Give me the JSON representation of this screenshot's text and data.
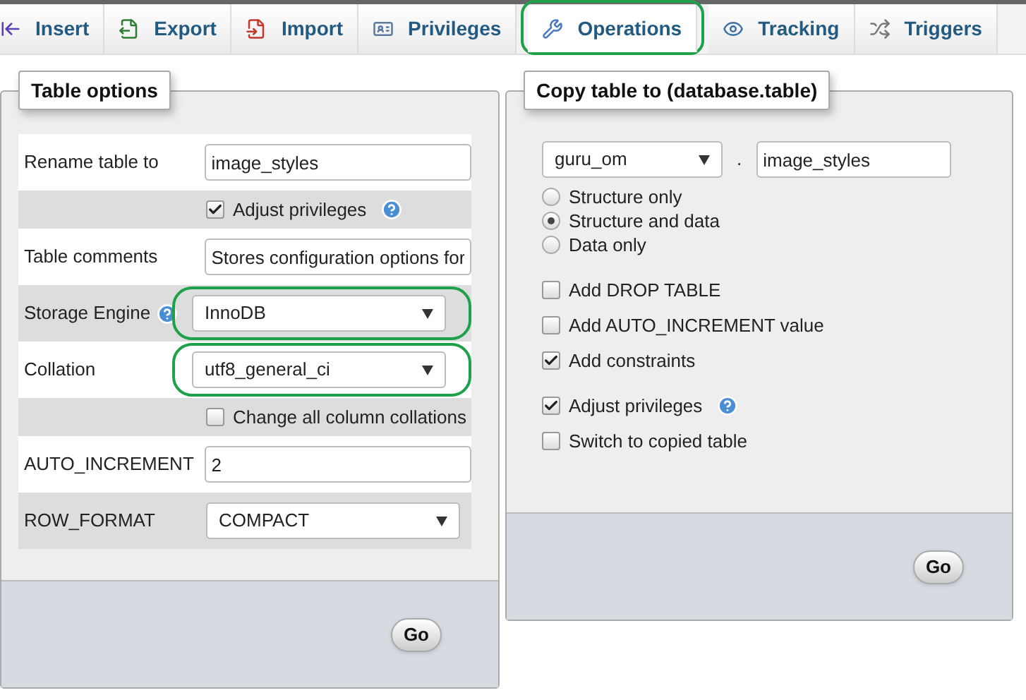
{
  "tabs": [
    {
      "label": "Insert",
      "selected": false,
      "highlighted": false
    },
    {
      "label": "Export",
      "selected": false,
      "highlighted": false
    },
    {
      "label": "Import",
      "selected": false,
      "highlighted": false
    },
    {
      "label": "Privileges",
      "selected": false,
      "highlighted": false
    },
    {
      "label": "Operations",
      "selected": true,
      "highlighted": true
    },
    {
      "label": "Tracking",
      "selected": false,
      "highlighted": false
    },
    {
      "label": "Triggers",
      "selected": false,
      "highlighted": false
    }
  ],
  "table_options": {
    "title": "Table options",
    "rows": [
      {
        "kind": "text",
        "label": "Rename table to",
        "value": "image_styles"
      },
      {
        "kind": "checkbox",
        "label": "Adjust privileges",
        "checked": true,
        "help": true
      },
      {
        "kind": "text",
        "label": "Table comments",
        "value": "Stores configuration options for"
      },
      {
        "kind": "select",
        "label": "Storage Engine",
        "value": "InnoDB",
        "help": true,
        "highlighted": true
      },
      {
        "kind": "select",
        "label": "Collation",
        "value": "utf8_general_ci",
        "help": false,
        "highlighted": true
      },
      {
        "kind": "checkbox",
        "label": "Change all column collations",
        "checked": false,
        "help": false
      },
      {
        "kind": "text",
        "label": "AUTO_INCREMENT",
        "value": "2"
      },
      {
        "kind": "select",
        "label": "ROW_FORMAT",
        "value": "COMPACT",
        "help": false,
        "highlighted": false
      }
    ],
    "button": "Go"
  },
  "copy_table": {
    "title": "Copy table to (database.table)",
    "database": "guru_om",
    "separator": ".",
    "table_name": "image_styles",
    "modes": [
      {
        "label": "Structure only",
        "selected": false
      },
      {
        "label": "Structure and data",
        "selected": true
      },
      {
        "label": "Data only",
        "selected": false
      }
    ],
    "option_groups": [
      [
        {
          "label": "Add DROP TABLE",
          "checked": false,
          "help": false
        },
        {
          "label": "Add AUTO_INCREMENT value",
          "checked": false,
          "help": false
        },
        {
          "label": "Add constraints",
          "checked": true,
          "help": false
        }
      ],
      [
        {
          "label": "Adjust privileges",
          "checked": true,
          "help": true
        },
        {
          "label": "Switch to copied table",
          "checked": false,
          "help": false
        }
      ]
    ],
    "button": "Go"
  }
}
